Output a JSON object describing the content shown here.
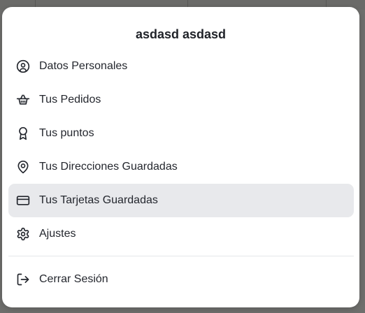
{
  "menu": {
    "title": "asdasd asdasd",
    "items": [
      {
        "label": "Datos Personales",
        "icon": "user-circle-icon"
      },
      {
        "label": "Tus Pedidos",
        "icon": "basket-icon"
      },
      {
        "label": "Tus puntos",
        "icon": "award-icon"
      },
      {
        "label": "Tus Direcciones Guardadas",
        "icon": "map-pin-icon"
      },
      {
        "label": "Tus Tarjetas Guardadas",
        "icon": "credit-card-icon"
      },
      {
        "label": "Ajustes",
        "icon": "gear-icon"
      }
    ],
    "logout": {
      "label": "Cerrar Sesión",
      "icon": "logout-icon"
    },
    "active_item": "Tus Tarjetas Guardadas"
  },
  "colors": {
    "backdrop": "#6e6e6c",
    "panel": "#ffffff",
    "active_bg": "#e8e9ec",
    "text": "#24272e"
  }
}
